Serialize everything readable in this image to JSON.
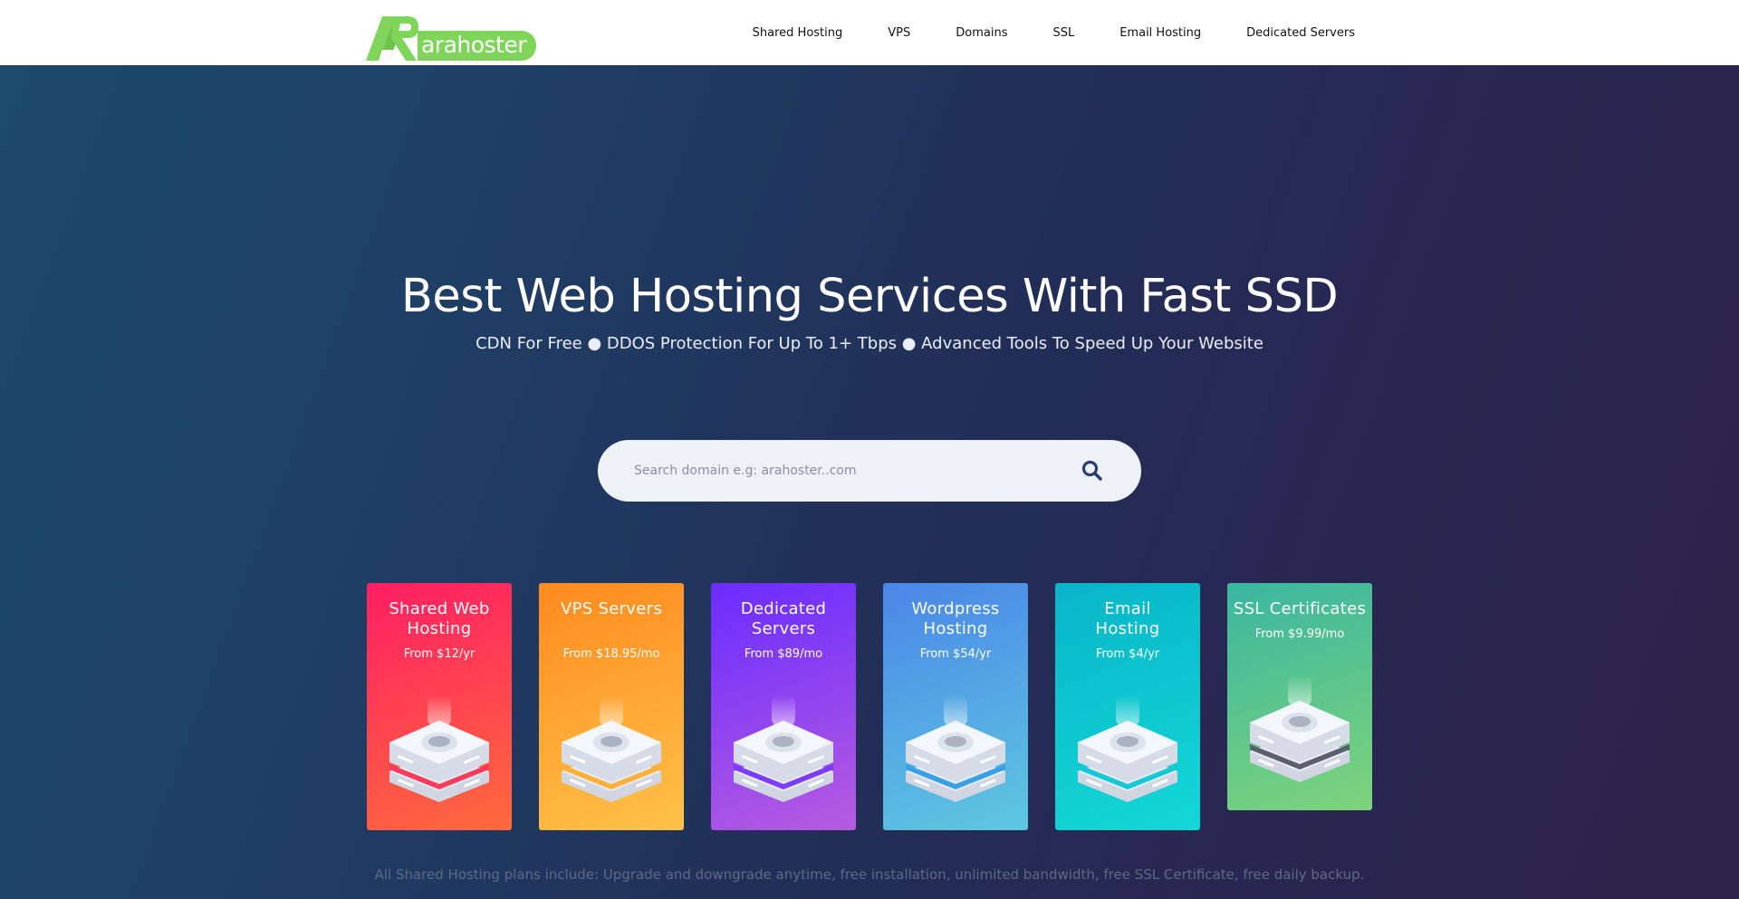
{
  "brand": {
    "name": "arahoster",
    "accent": "#7fd45a"
  },
  "nav": {
    "items": [
      "Shared Hosting",
      "VPS",
      "Domains",
      "SSL",
      "Email Hosting",
      "Dedicated Servers"
    ]
  },
  "hero": {
    "title": "Best Web Hosting Services With Fast SSD",
    "subtitle": "CDN For Free ● DDOS Protection For Up To 1+ Tbps ● Advanced Tools To Speed Up Your Website"
  },
  "search": {
    "placeholder": "Search domain e.g: arahoster..com",
    "icon": "search-icon"
  },
  "cards": [
    {
      "title": "Shared Web Hosting",
      "price": "From $12/yr",
      "gradient": [
        "#ff1e63",
        "#ff6a3d"
      ],
      "ring": "#ff3a5a",
      "icon": "server-grid-icon"
    },
    {
      "title": "VPS Servers",
      "price": "From $18.95/mo",
      "gradient": [
        "#ff8a1e",
        "#ffc24a"
      ],
      "ring": "#ffb03a",
      "icon": "vps-icon"
    },
    {
      "title": "Dedicated Servers",
      "price": "From $89/mo",
      "gradient": [
        "#6a2cff",
        "#b65ce0"
      ],
      "ring": "#7b3cff",
      "icon": "dedicated-icon"
    },
    {
      "title": "Wordpress Hosting",
      "price": "From $54/yr",
      "gradient": [
        "#4a86e8",
        "#5ec8e0"
      ],
      "ring": "#3aa0e6",
      "icon": "wordpress-icon"
    },
    {
      "title": "Email Hosting",
      "price": "From $4/yr",
      "gradient": [
        "#08b5c8",
        "#13d8d6"
      ],
      "ring": "#14c8d6",
      "icon": "cloud-icon"
    },
    {
      "title": "SSL Certificates",
      "price": "From $9.99/mo",
      "gradient": [
        "#3ab6a0",
        "#7ed47a"
      ],
      "ring": "#5a6070",
      "icon": "lock-icon"
    }
  ],
  "footer_note": "All Shared Hosting plans include: Upgrade and downgrade anytime, free installation, unlimited bandwidth, free SSL Certificate, free daily backup."
}
